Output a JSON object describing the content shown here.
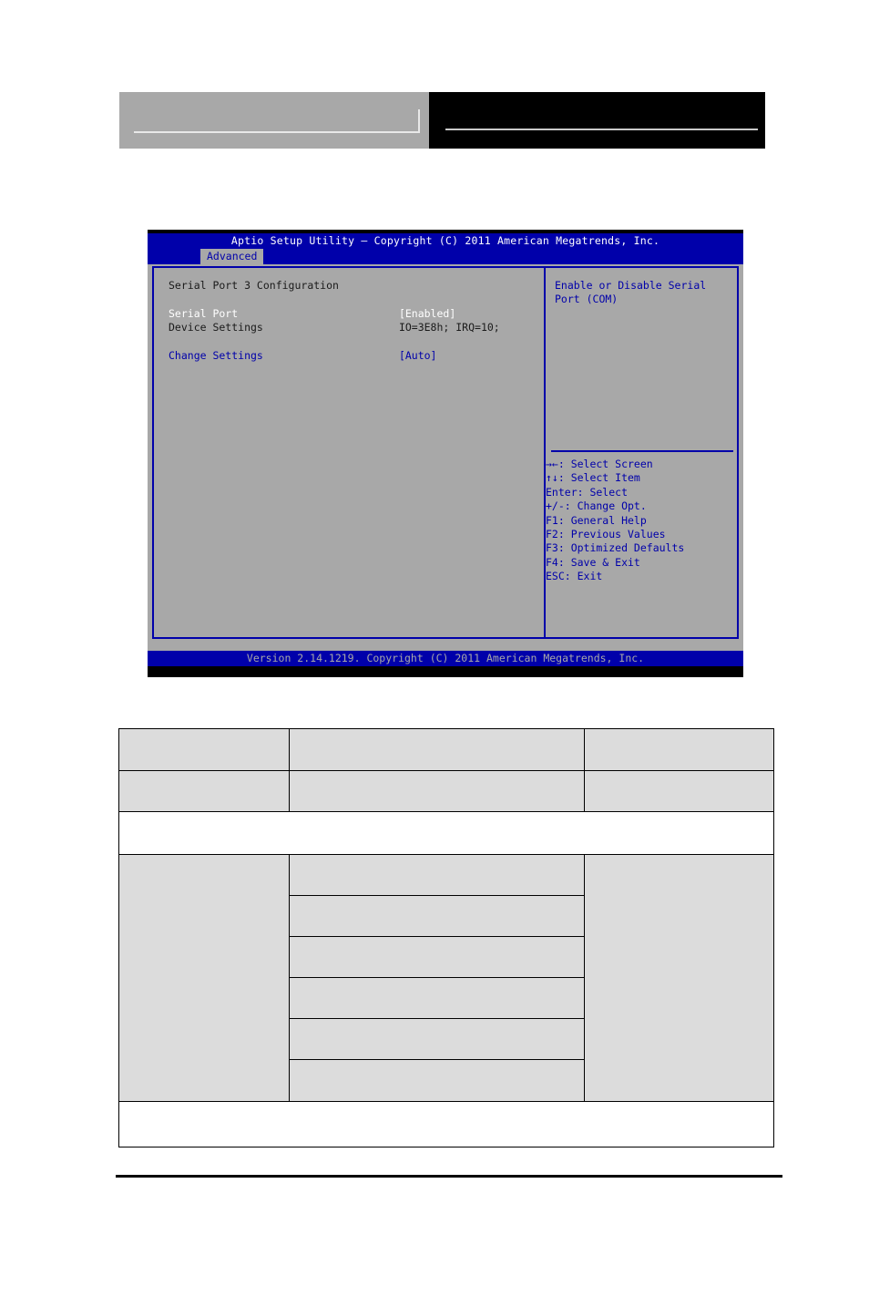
{
  "page": {
    "header": {
      "left_block": "",
      "right_block": ""
    }
  },
  "bios": {
    "title": "Aptio Setup Utility – Copyright (C) 2011 American Megatrends, Inc.",
    "tab": "Advanced",
    "section_title": "Serial Port 3 Configuration",
    "options": [
      {
        "label": "Serial Port",
        "value": "[Enabled]",
        "style": "white"
      },
      {
        "label": "Device Settings",
        "value": "IO=3E8h; IRQ=10;",
        "style": "dark"
      },
      {
        "label": "Change Settings",
        "value": "[Auto]",
        "style": "blue"
      }
    ],
    "help_text": "Enable or Disable Serial Port (COM)",
    "nav_keys": [
      "→←: Select Screen",
      "↑↓: Select Item",
      "Enter: Select",
      "+/-: Change Opt.",
      "F1: General Help",
      "F2: Previous Values",
      "F3: Optimized Defaults",
      "F4: Save & Exit",
      "ESC: Exit"
    ],
    "footer": "Version 2.14.1219. Copyright (C) 2011 American Megatrends, Inc.",
    "colors": {
      "background": "#0000aa",
      "panel": "#a8a8a8",
      "accent_text": "#0000aa",
      "highlight_text": "#ffffff",
      "body_text": "#1a1a1a"
    }
  },
  "spec_table": {
    "rows": [
      {
        "cells": [
          "",
          "",
          ""
        ],
        "shaded": true
      },
      {
        "cells": [
          "",
          "",
          ""
        ],
        "shaded": true
      },
      {
        "cells": [
          ""
        ],
        "shaded": false
      },
      {
        "cells": [
          "",
          "",
          ""
        ],
        "shaded": true
      },
      {
        "cells": [
          "",
          ""
        ],
        "shaded": true
      },
      {
        "cells": [
          "",
          ""
        ],
        "shaded": true
      },
      {
        "cells": [
          "",
          ""
        ],
        "shaded": true
      },
      {
        "cells": [
          "",
          ""
        ],
        "shaded": true
      },
      {
        "cells": [
          "",
          ""
        ],
        "shaded": true
      },
      {
        "cells": [
          ""
        ],
        "shaded": false
      }
    ]
  }
}
